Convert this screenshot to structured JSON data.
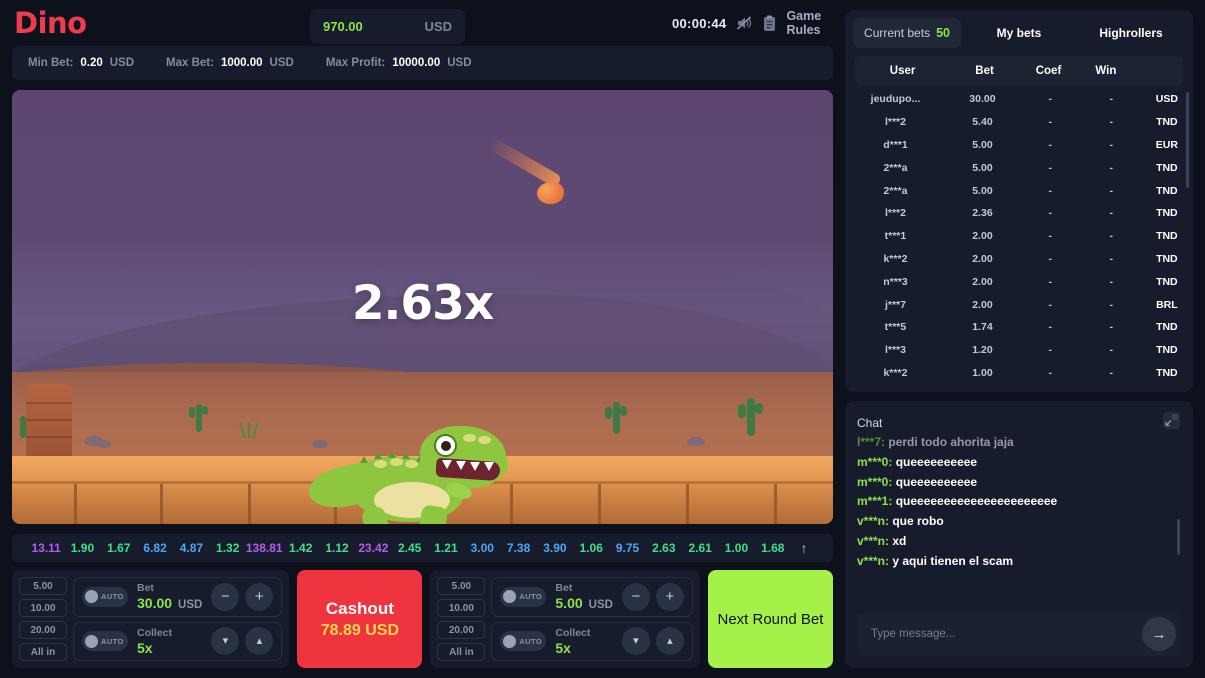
{
  "header": {
    "logo": "Dino",
    "balance": {
      "amount": "970.00",
      "currency": "USD"
    },
    "timer": "00:00:44",
    "sound_icon": "sound-muted-icon",
    "rules_icon": "clipboard-icon",
    "rules_label": "Game Rules"
  },
  "limits": {
    "min_bet_label": "Min Bet:",
    "min_bet_value": "0.20",
    "min_bet_currency": "USD",
    "max_bet_label": "Max Bet:",
    "max_bet_value": "1000.00",
    "max_bet_currency": "USD",
    "max_profit_label": "Max Profit:",
    "max_profit_value": "10000.00",
    "max_profit_currency": "USD"
  },
  "stage": {
    "multiplier": "2.63x",
    "character": "dinosaur-trex",
    "meteor": "meteor-icon"
  },
  "history": {
    "scroll_icon": "arrow-up-icon",
    "items": [
      {
        "value": "13.11",
        "color": "#b35cf0"
      },
      {
        "value": "1.90",
        "color": "#3ce08a"
      },
      {
        "value": "1.67",
        "color": "#3ce08a"
      },
      {
        "value": "6.82",
        "color": "#4da6f5"
      },
      {
        "value": "4.87",
        "color": "#4da6f5"
      },
      {
        "value": "1.32",
        "color": "#3ce08a"
      },
      {
        "value": "138.81",
        "color": "#b35cf0"
      },
      {
        "value": "1.42",
        "color": "#3ce08a"
      },
      {
        "value": "1.12",
        "color": "#3ce08a"
      },
      {
        "value": "23.42",
        "color": "#b35cf0"
      },
      {
        "value": "2.45",
        "color": "#3ce08a"
      },
      {
        "value": "1.21",
        "color": "#3ce08a"
      },
      {
        "value": "3.00",
        "color": "#4da6f5"
      },
      {
        "value": "7.38",
        "color": "#4da6f5"
      },
      {
        "value": "3.90",
        "color": "#4da6f5"
      },
      {
        "value": "1.06",
        "color": "#3ce08a"
      },
      {
        "value": "9.75",
        "color": "#4da6f5"
      },
      {
        "value": "2.63",
        "color": "#3ce08a"
      },
      {
        "value": "2.61",
        "color": "#3ce08a"
      },
      {
        "value": "1.00",
        "color": "#3ce08a"
      },
      {
        "value": "1.68",
        "color": "#3ce08a"
      }
    ]
  },
  "controls": {
    "quick_amounts": [
      "5.00",
      "10.00",
      "20.00",
      "All in"
    ],
    "auto_label": "AUTO",
    "left_panel": {
      "bet_label": "Bet",
      "bet_value": "30.00",
      "bet_currency": "USD",
      "collect_label": "Collect",
      "collect_value": "5x",
      "minus_icon": "minus-icon",
      "plus_icon": "plus-icon",
      "down_icon": "chevron-down-icon",
      "up_icon": "chevron-up-icon"
    },
    "cashout": {
      "label": "Cashout",
      "value": "78.89",
      "currency": "USD"
    },
    "right_panel": {
      "bet_label": "Bet",
      "bet_value": "5.00",
      "bet_currency": "USD",
      "collect_label": "Collect",
      "collect_value": "5x",
      "minus_icon": "minus-icon",
      "plus_icon": "plus-icon",
      "down_icon": "chevron-down-icon",
      "up_icon": "chevron-up-icon"
    },
    "next_round": "Next Round Bet"
  },
  "bets": {
    "tabs": [
      {
        "label": "Current bets",
        "count": "50",
        "active": true
      },
      {
        "label": "My bets",
        "count": "",
        "active": false
      },
      {
        "label": "Highrollers",
        "count": "",
        "active": false
      }
    ],
    "columns": [
      "User",
      "Bet",
      "Coef",
      "Win"
    ],
    "rows": [
      {
        "user": "jeudupo...",
        "bet": "30.00",
        "coef": "-",
        "win": "-",
        "currency": "USD"
      },
      {
        "user": "l***2",
        "bet": "5.40",
        "coef": "-",
        "win": "-",
        "currency": "TND"
      },
      {
        "user": "d***1",
        "bet": "5.00",
        "coef": "-",
        "win": "-",
        "currency": "EUR"
      },
      {
        "user": "2***a",
        "bet": "5.00",
        "coef": "-",
        "win": "-",
        "currency": "TND"
      },
      {
        "user": "2***a",
        "bet": "5.00",
        "coef": "-",
        "win": "-",
        "currency": "TND"
      },
      {
        "user": "l***2",
        "bet": "2.36",
        "coef": "-",
        "win": "-",
        "currency": "TND"
      },
      {
        "user": "t***1",
        "bet": "2.00",
        "coef": "-",
        "win": "-",
        "currency": "TND"
      },
      {
        "user": "k***2",
        "bet": "2.00",
        "coef": "-",
        "win": "-",
        "currency": "TND"
      },
      {
        "user": "n***3",
        "bet": "2.00",
        "coef": "-",
        "win": "-",
        "currency": "TND"
      },
      {
        "user": "j***7",
        "bet": "2.00",
        "coef": "-",
        "win": "-",
        "currency": "BRL"
      },
      {
        "user": "t***5",
        "bet": "1.74",
        "coef": "-",
        "win": "-",
        "currency": "TND"
      },
      {
        "user": "l***3",
        "bet": "1.20",
        "coef": "-",
        "win": "-",
        "currency": "TND"
      },
      {
        "user": "k***2",
        "bet": "1.00",
        "coef": "-",
        "win": "-",
        "currency": "TND"
      }
    ]
  },
  "chat": {
    "title": "Chat",
    "expand_icon": "expand-icon",
    "messages": [
      {
        "who": "l***7:",
        "text": "perdi todo ahorita jaja",
        "clipped": true
      },
      {
        "who": "m***0:",
        "text": "queeeeeeeeee"
      },
      {
        "who": "m***0:",
        "text": "queeeeeeeeee"
      },
      {
        "who": "m***1:",
        "text": "queeeeeeeeeeeeeeeeeeeeee"
      },
      {
        "who": "v***n:",
        "text": "que robo"
      },
      {
        "who": "v***n:",
        "text": "xd"
      },
      {
        "who": "v***n:",
        "text": "y aqui tienen el scam"
      }
    ],
    "input_placeholder": "Type message...",
    "send_icon": "send-arrow-icon"
  }
}
